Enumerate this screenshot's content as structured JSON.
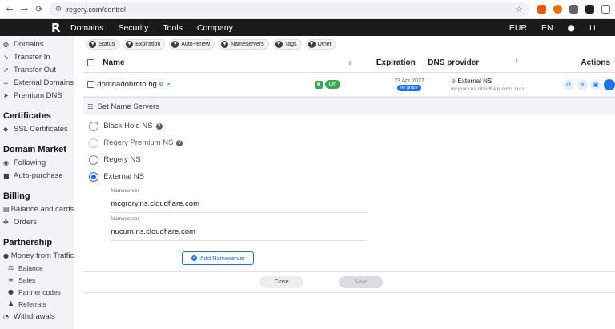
{
  "browser": {
    "url": "regery.com/control"
  },
  "header": {
    "logo": "R",
    "nav": [
      "Domains",
      "Security",
      "Tools",
      "Company"
    ],
    "currency": "EUR",
    "language": "EN",
    "account_icon": "user-icon",
    "cart_icon": "cart-icon"
  },
  "sidebar": {
    "top_items": [
      {
        "label": "Domains",
        "icon": "globe-icon"
      },
      {
        "label": "Transfer In",
        "icon": "transfer-in-icon"
      },
      {
        "label": "Transfer Out",
        "icon": "transfer-out-icon"
      },
      {
        "label": "External Domains",
        "icon": "link-icon"
      },
      {
        "label": "Premium DNS",
        "icon": "send-icon"
      }
    ],
    "sections": [
      {
        "title": "Certificates",
        "items": [
          {
            "label": "SSL Certificates",
            "icon": "shield-icon"
          }
        ]
      },
      {
        "title": "Domain Market",
        "items": [
          {
            "label": "Following",
            "icon": "eye-icon"
          },
          {
            "label": "Auto-purchase",
            "icon": "car-icon"
          }
        ]
      },
      {
        "title": "Billing",
        "items": [
          {
            "label": "Balance and cards",
            "icon": "wallet-icon"
          },
          {
            "label": "Orders",
            "icon": "orders-icon"
          }
        ]
      }
    ],
    "partnership": {
      "title": "Partnership",
      "money": "Money from Traffic",
      "sub": [
        "Balance",
        "Sales",
        "Partner codes",
        "Referrals"
      ],
      "withdrawals": "Withdrawals"
    }
  },
  "filters": [
    "Status",
    "Expiration",
    "Auto-renew",
    "Nameservers",
    "Tags",
    "Other"
  ],
  "table": {
    "headers": {
      "name": "Name",
      "expiration": "Expiration",
      "dns": "DNS provider",
      "actions": "Actions"
    },
    "row": {
      "domain": "domnadobroto.bg",
      "status": "On",
      "expiration": "23 Apr 2027",
      "grace": "no grace",
      "dns_name": "External NS",
      "dns_servers": "mcgrory.ns.cloudflare.com, nucu..."
    }
  },
  "ns_panel": {
    "title": "Set Name Servers",
    "options": [
      {
        "label": "Black Hole NS",
        "help": "?"
      },
      {
        "label": "Regery Premium NS",
        "help": "?"
      },
      {
        "label": "Regery NS"
      },
      {
        "label": "External NS"
      }
    ],
    "field_label": "Nameserver",
    "nameservers": [
      "mcgrory.ns.cloudflare.com",
      "nucum.ns.cloudflare.com"
    ],
    "add_label": "Add Nameserver",
    "close_label": "Close",
    "save_label": "Save"
  },
  "colors": {
    "accent": "#1a73e8",
    "status_on": "#34a853",
    "header_bg": "#1a1a1a"
  }
}
